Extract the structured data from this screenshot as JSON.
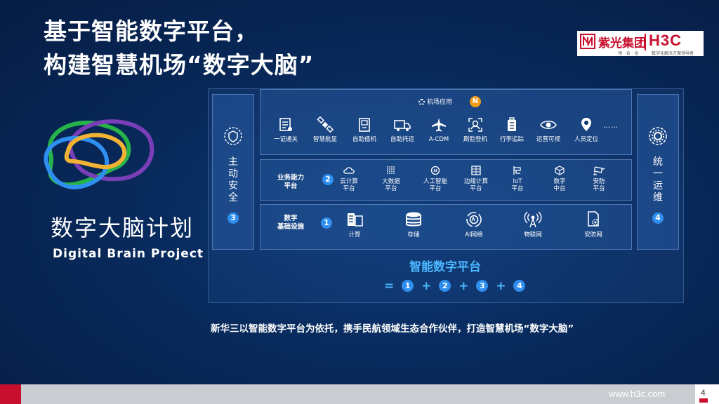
{
  "title": {
    "line1": "基于智能数字平台，",
    "line2": "构建智慧机场“数字大脑”"
  },
  "logo": {
    "cn": "紫光集团",
    "brand": "H3C",
    "slogan1": "领 · 合 · 全",
    "slogan2": "数字化解决方案领导者"
  },
  "brain_project": {
    "cn": "数字大脑计划",
    "en": "Digital Brain Project"
  },
  "left_column": {
    "label": "主动安全",
    "number": "3",
    "icon": "shield-network-icon"
  },
  "right_column": {
    "label": "统一运维",
    "number": "4",
    "icon": "gear-cycle-icon"
  },
  "app_layer": {
    "heading": "机场应用",
    "badge": "N",
    "items": [
      {
        "label": "一证通关",
        "icon": "id-card-icon"
      },
      {
        "label": "智慧航显",
        "icon": "satellite-icon"
      },
      {
        "label": "自助值机",
        "icon": "kiosk-icon"
      },
      {
        "label": "自助托运",
        "icon": "truck-icon"
      },
      {
        "label": "A-CDM",
        "icon": "airplane-icon"
      },
      {
        "label": "刷脸登机",
        "icon": "face-scan-icon"
      },
      {
        "label": "行李追踪",
        "icon": "luggage-icon"
      },
      {
        "label": "运营可视",
        "icon": "eye-icon"
      },
      {
        "label": "人员定位",
        "icon": "location-pin-icon"
      }
    ],
    "more": "……"
  },
  "biz_layer": {
    "label_line1": "业务能力",
    "label_line2": "平台",
    "number": "2",
    "items": [
      {
        "line1": "云计算",
        "line2": "平台",
        "icon": "cloud-compute-icon"
      },
      {
        "line1": "大数据",
        "line2": "平台",
        "icon": "big-data-icon"
      },
      {
        "line1": "人工智能",
        "line2": "平台",
        "icon": "ai-chip-icon"
      },
      {
        "line1": "边缘计算",
        "line2": "平台",
        "icon": "edge-compute-icon"
      },
      {
        "line1": "IoT",
        "line2": "平台",
        "icon": "iot-icon"
      },
      {
        "line1": "数字",
        "line2": "中台",
        "icon": "cube-icon"
      },
      {
        "line1": "安防",
        "line2": "平台",
        "icon": "camera-icon"
      }
    ]
  },
  "infra_layer": {
    "label_line1": "数字",
    "label_line2": "基础设施",
    "number": "1",
    "items": [
      {
        "label": "计算",
        "icon": "server-icon"
      },
      {
        "label": "存储",
        "icon": "storage-icon"
      },
      {
        "label": "AI网络",
        "icon": "ai-network-icon"
      },
      {
        "label": "物联网",
        "icon": "antenna-icon"
      },
      {
        "label": "安防网",
        "icon": "security-network-icon"
      }
    ]
  },
  "platform": {
    "title": "智能数字平台",
    "formula": {
      "eq": "=",
      "plus": "+",
      "n1": "1",
      "n2": "2",
      "n3": "3",
      "n4": "4"
    }
  },
  "caption": "新华三以智能数字平台为依托，携手民航领域生态合作伙伴，打造智慧机场“数字大脑”",
  "footer": {
    "url": "www.h3c.com",
    "page": "4"
  },
  "colors": {
    "accent": "#2f8ff0",
    "highlight": "#4bb8ff",
    "brand": "#c8102e",
    "badge_orange": "#f09a1a"
  }
}
